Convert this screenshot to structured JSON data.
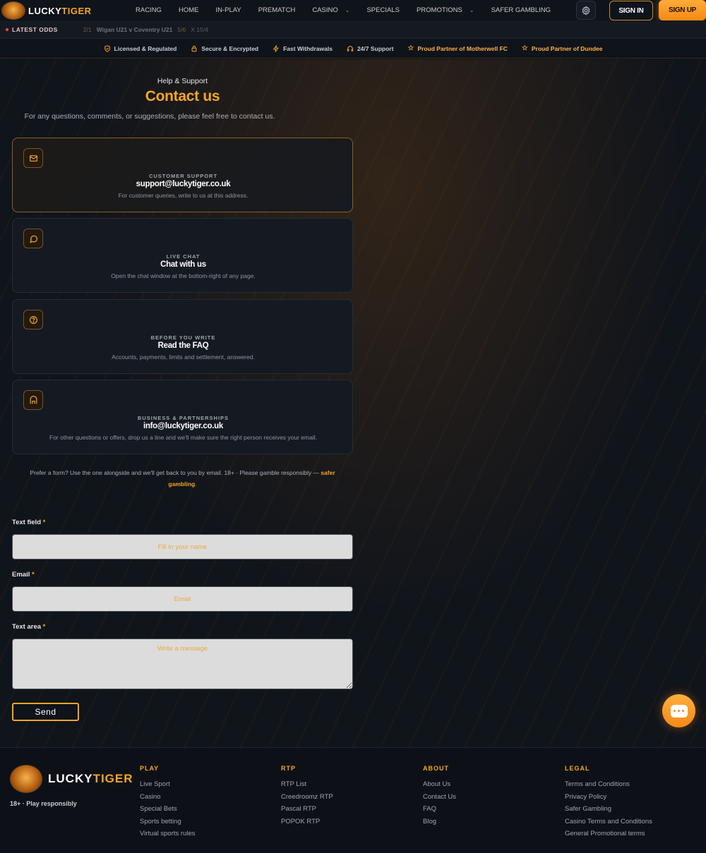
{
  "header": {
    "logo_primary": "LUCKY",
    "logo_secondary": "TIGER",
    "nav": [
      {
        "label": "RACING",
        "has_dropdown": false
      },
      {
        "label": "HOME",
        "has_dropdown": false
      },
      {
        "label": "IN-PLAY",
        "has_dropdown": false
      },
      {
        "label": "PREMATCH",
        "has_dropdown": false
      },
      {
        "label": "CASINO",
        "has_dropdown": true
      },
      {
        "label": "SPECIALS",
        "has_dropdown": false
      },
      {
        "label": "PROMOTIONS",
        "has_dropdown": true
      },
      {
        "label": "SAFER GAMBLING",
        "has_dropdown": false
      }
    ],
    "settings_icon": "gear-icon",
    "sign_in": "SIGN IN",
    "sign_up": "SIGN UP"
  },
  "odds_bar": {
    "label": "LATEST ODDS",
    "odds_before": "2/1",
    "match": "Wigan U21 v Coventry U21",
    "odds_after": "5/6",
    "odds_extra": "X 15/4"
  },
  "trust_bar": [
    {
      "label": "Licensed & Regulated",
      "icon": "shield-check-icon",
      "partner": false
    },
    {
      "label": "Secure & Encrypted",
      "icon": "lock-icon",
      "partner": false
    },
    {
      "label": "Fast Withdrawals",
      "icon": "lightning-icon",
      "partner": false
    },
    {
      "label": "24/7 Support",
      "icon": "headset-icon",
      "partner": false
    },
    {
      "label": "Proud Partner of Motherwell FC",
      "icon": "star-icon",
      "partner": true
    },
    {
      "label": "Proud Partner of Dundee",
      "icon": "star-icon",
      "partner": true
    }
  ],
  "hero": {
    "subtitle": "Help & Support",
    "title": "Contact us",
    "description": "For any questions, comments, or suggestions, please feel free to contact us."
  },
  "cards": [
    {
      "icon": "mail-icon",
      "kicker": "CUSTOMER SUPPORT",
      "title": "support@luckytiger.co.uk",
      "desc": "For customer queries, write to us at this address.",
      "active": true
    },
    {
      "icon": "chat-bubble-icon",
      "kicker": "LIVE CHAT",
      "title": "Chat with us",
      "desc": "Open the chat window at the bottom-right of any page.",
      "active": false
    },
    {
      "icon": "question-circle-icon",
      "kicker": "BEFORE YOU WRITE",
      "title": "Read the FAQ",
      "desc": "Accounts, payments, limits and settlement, answered.",
      "active": false
    },
    {
      "icon": "building-icon",
      "kicker": "BUSINESS & PARTNERSHIPS",
      "title": "info@luckytiger.co.uk",
      "desc": "For other questions or offers, drop us a line and we'll make sure the right person receives your email.",
      "active": false
    }
  ],
  "note": {
    "text": "Prefer a form? Use the one alongside and we'll get back to you by email. 18+ · Please gamble responsibly — ",
    "link": "safer gambling",
    "end": "."
  },
  "form": {
    "name_label": "Text field",
    "name_placeholder": "Fill in your name",
    "email_label": "Email",
    "email_placeholder": "Email",
    "message_label": "Text area",
    "message_placeholder": "Write a message",
    "required_mark": "*",
    "send": "Send"
  },
  "footer": {
    "logo_primary": "LUCKY",
    "logo_secondary": "TIGER",
    "responsible": "18+ · Play responsibly",
    "columns": [
      {
        "title": "PLAY",
        "links": [
          "Live Sport",
          "Casino",
          "Special Bets",
          "Sports betting",
          "Virtual sports rules"
        ]
      },
      {
        "title": "RTP",
        "links": [
          "RTP List",
          "Creedroomz RTP",
          "Pascal RTP",
          "POPOK RTP"
        ]
      },
      {
        "title": "ABOUT",
        "links": [
          "About Us",
          "Contact Us",
          "FAQ",
          "Blog"
        ]
      },
      {
        "title": "LEGAL",
        "links": [
          "Terms and Conditions",
          "Privacy Policy",
          "Safer Gambling",
          "Casino Terms and Conditions",
          "General Promotional terms"
        ]
      }
    ]
  },
  "colors": {
    "accent": "#f5a623",
    "background": "#0d1118",
    "live": "#e84a4a"
  }
}
